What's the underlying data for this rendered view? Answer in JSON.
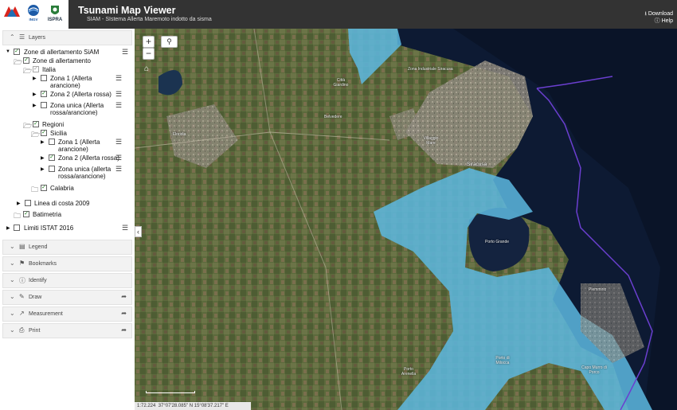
{
  "header": {
    "logos": [
      {
        "name": "protezione-civile-logo",
        "text": "PROTEZIONE CIVILE"
      },
      {
        "name": "ingv-logo",
        "text": "INGV"
      },
      {
        "name": "ispra-logo",
        "text": "ISPRA"
      }
    ],
    "title": "Tsunami Map Viewer",
    "subtitle": "SIAM - SIstema Allerta Maremoto indotto da sisma",
    "download": "Download",
    "help": "Help"
  },
  "sidebar": {
    "layers_title": "Layers",
    "tree": [
      {
        "label": "Zone di allertamento SiAM",
        "checked": true
      },
      {
        "label": "Zone di allertamento",
        "checked": true
      },
      {
        "label": "Italia",
        "checked": true
      },
      {
        "label": "Zona 1 (Allerta arancione)",
        "checked": false
      },
      {
        "label": "Zona 2 (Allerta rossa)",
        "checked": true
      },
      {
        "label": "Zona unica (Allerta rossa/arancione)",
        "checked": false
      },
      {
        "label": "Regioni",
        "checked": true
      },
      {
        "label": "Sicilia",
        "checked": true
      },
      {
        "label": "Zona 1 (Allerta arancione)",
        "checked": false
      },
      {
        "label": "Zona 2 (Allerta rossa)",
        "checked": true
      },
      {
        "label": "Zona unica (allerta rossa/arancione)",
        "checked": false
      },
      {
        "label": "Calabria",
        "checked": true
      },
      {
        "label": "Linea di costa 2009",
        "checked": false
      },
      {
        "label": "Batimetria",
        "checked": true
      },
      {
        "label": "Limiti ISTAT 2016",
        "checked": false
      }
    ],
    "panels": [
      "Legend",
      "Bookmarks",
      "Identify",
      "Draw",
      "Measurement",
      "Print"
    ]
  },
  "map": {
    "labels": [
      "Zona Industriale Siracusa",
      "Città Giardino",
      "Belvedere",
      "Floridia",
      "Villaggio Mare",
      "Siracusa",
      "Porto Grande",
      "Plemmirio",
      "Porto di Milocca",
      "Capo Murro di Porco",
      "Porto Arenella"
    ],
    "scale_text": "1:72.224",
    "coordinates": "37°07'28.085\" N   15°08'37.217\" E"
  }
}
